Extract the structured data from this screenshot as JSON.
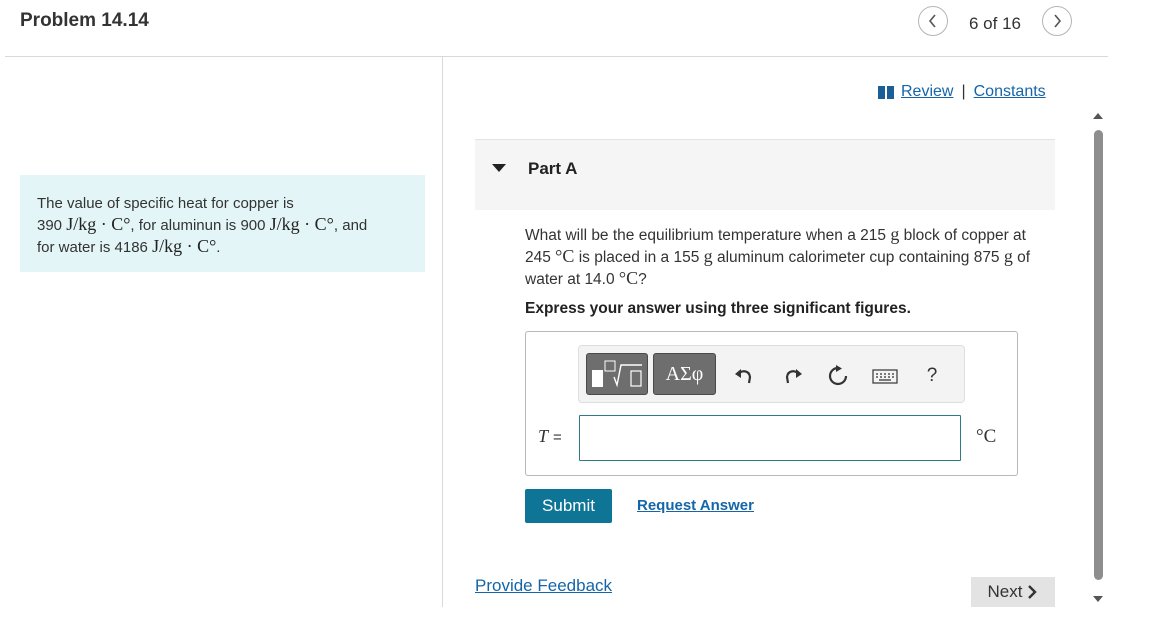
{
  "header": {
    "title": "Problem 14.14",
    "pager": "6 of 16",
    "prev_icon": "chevron-left-icon",
    "next_icon": "chevron-right-icon"
  },
  "info": {
    "p1": "The value of specific heat for copper is",
    "v1": "390",
    "u1": "J/kg · C°",
    "p2": ", for aluminun is 900",
    "u2": "J/kg · C°",
    "p3": ", and",
    "p4": "for water is 4186",
    "u3": "J/kg · C°",
    "p5": "."
  },
  "links": {
    "review": "Review",
    "separator": "|",
    "constants": "Constants",
    "book_icon": "book-icon"
  },
  "part": {
    "label": "Part A"
  },
  "question": {
    "t1": "What will be the equilibrium temperature when a 215 ",
    "u1": "g",
    "t2": " block of copper at 245 ",
    "u2": "°C",
    "t3": " is placed in a 155 ",
    "u3": "g",
    "t4": " aluminum calorimeter cup containing 875 ",
    "u4": "g",
    "t5": " of water at 14.0 ",
    "u5": "°C",
    "t6": "?"
  },
  "instruction": "Express your answer using three significant figures.",
  "toolbar": {
    "templates_label": "√",
    "greek_label": "ΑΣφ",
    "help_label": "?"
  },
  "answer": {
    "variable": "T",
    "equals": "=",
    "value": "",
    "unit": "°C"
  },
  "actions": {
    "submit": "Submit",
    "request_answer": "Request Answer",
    "feedback": "Provide Feedback",
    "next": "Next"
  },
  "colors": {
    "accent": "#0f7596",
    "link": "#1565a8",
    "info_bg": "#e3f5f6"
  }
}
